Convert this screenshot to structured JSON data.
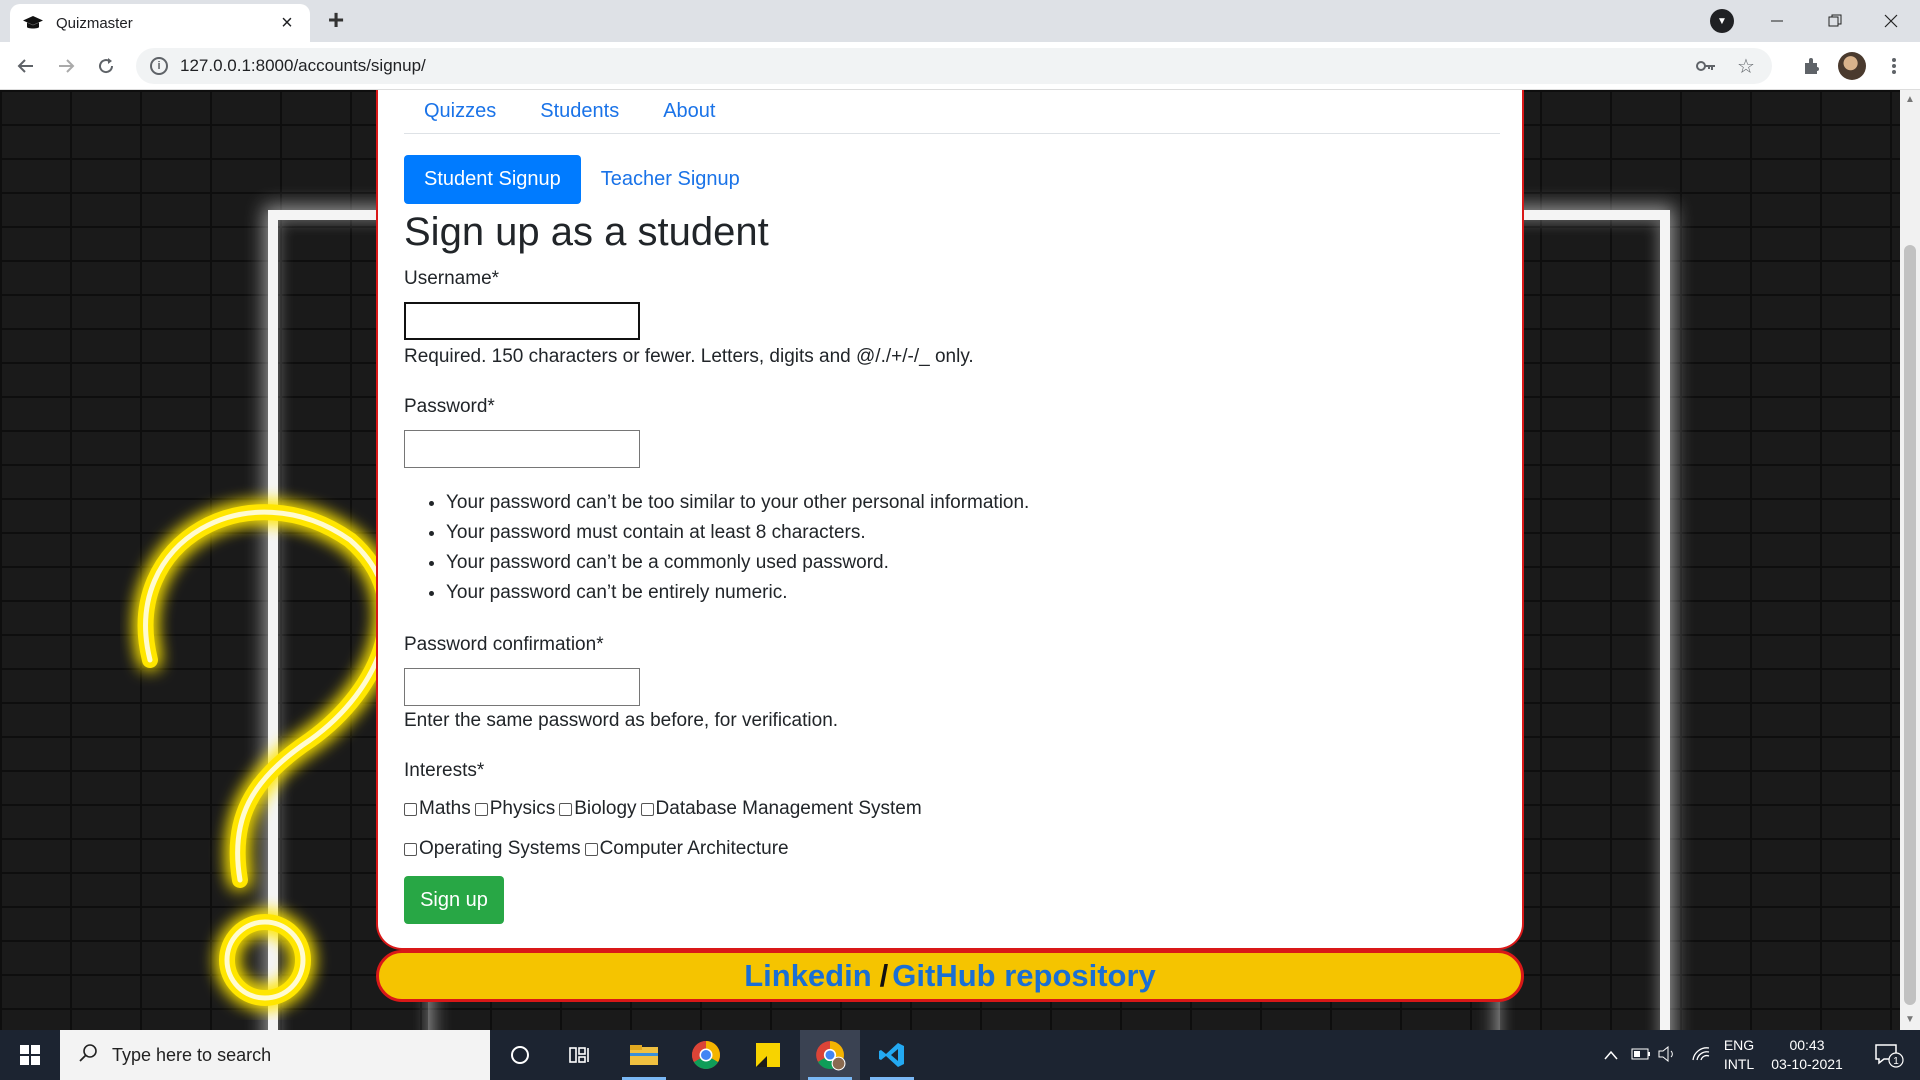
{
  "browser": {
    "tab_title": "Quizmaster",
    "tab_close": "×",
    "new_tab": "+",
    "url": "127.0.0.1:8000/accounts/signup/"
  },
  "nav": {
    "links": [
      "Quizzes",
      "Students",
      "About"
    ]
  },
  "signup_tabs": {
    "student": "Student Signup",
    "teacher": "Teacher Signup"
  },
  "form": {
    "heading": "Sign up as a student",
    "username_label": "Username*",
    "username_help": "Required. 150 characters or fewer. Letters, digits and @/./+/-/_ only.",
    "password_label": "Password*",
    "password_rules": [
      "Your password can’t be too similar to your other personal information.",
      "Your password must contain at least 8 characters.",
      "Your password can’t be a commonly used password.",
      "Your password can’t be entirely numeric."
    ],
    "confirm_label": "Password confirmation*",
    "confirm_help": "Enter the same password as before, for verification.",
    "interests_label": "Interests*",
    "interests": [
      "Maths",
      "Physics",
      "Biology",
      "Database Management System",
      "Operating Systems",
      "Computer Architecture"
    ],
    "submit": "Sign up"
  },
  "footer": {
    "linkedin": "Linkedin",
    "separator": "/",
    "github": "GitHub repository"
  },
  "taskbar": {
    "search_placeholder": "Type here to search",
    "lang_top": "ENG",
    "lang_bottom": "INTL",
    "time": "00:43",
    "date": "03-10-2021",
    "notification_count": "1"
  },
  "colors": {
    "accent_blue": "#007bff",
    "submit_green": "#28a745",
    "card_border": "#d91818",
    "footer_yellow": "#f5c400",
    "neon_yellow": "#ffe600"
  }
}
